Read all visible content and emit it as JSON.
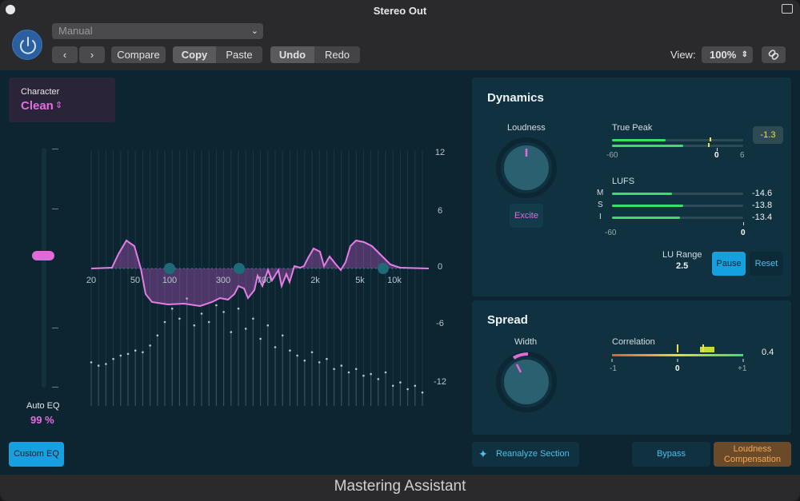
{
  "window": {
    "title": "Stereo Out",
    "footer_title": "Mastering Assistant"
  },
  "toolbar": {
    "preset": "Manual",
    "prev_label": "‹",
    "next_label": "›",
    "compare": "Compare",
    "copy": "Copy",
    "paste": "Paste",
    "undo": "Undo",
    "redo": "Redo",
    "view_label": "View:",
    "zoom": "100%"
  },
  "eq": {
    "character_label": "Character",
    "character_value": "Clean",
    "auto_eq_label": "Auto EQ",
    "auto_eq_value": "99 %",
    "custom_eq": "Custom EQ",
    "freq_labels": [
      "20",
      "50",
      "100",
      "300",
      "700",
      "2k",
      "5k",
      "10k"
    ],
    "db_labels": [
      "12",
      "6",
      "0",
      "-6",
      "-12"
    ],
    "auto_eq_level": 0.55
  },
  "dynamics": {
    "title": "Dynamics",
    "loudness_label": "Loudness",
    "excite": "Excite",
    "true_peak_label": "True Peak",
    "true_peak_value": "-1.3",
    "true_peak_scale": [
      "-60",
      "0",
      "6"
    ],
    "lufs_label": "LUFS",
    "lufs_rows": [
      {
        "label": "M",
        "value": "-14.6",
        "level": 0.46
      },
      {
        "label": "S",
        "value": "-13.8",
        "level": 0.54
      },
      {
        "label": "I",
        "value": "-13.4",
        "level": 0.52
      }
    ],
    "lufs_scale": [
      "-60",
      "0"
    ],
    "true_peak_levels": [
      0.41,
      0.54
    ],
    "lu_range_label": "LU Range",
    "lu_range_value": "2.5",
    "pause": "Pause",
    "reset": "Reset"
  },
  "spread": {
    "title": "Spread",
    "width_label": "Width",
    "correlation_label": "Correlation",
    "correlation_value": "0.4",
    "correlation_scale": [
      "-1",
      "0",
      "+1"
    ]
  },
  "bottom": {
    "reanalyze": "Reanalyze Section",
    "bypass": "Bypass",
    "loudness_comp_line1": "Loudness",
    "loudness_comp_line2": "Compensation"
  },
  "colors": {
    "accent_pink": "#e06ad8",
    "accent_blue": "#16a0e0",
    "meter_green": "#3fdc6a",
    "loudness_comp": "#e69b4a"
  }
}
